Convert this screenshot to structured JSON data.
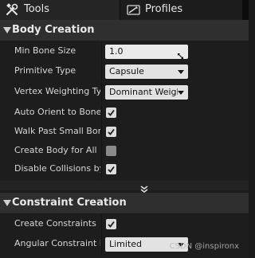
{
  "tabs": [
    {
      "label": "Tools",
      "icon": "tools-icon",
      "active": true
    },
    {
      "label": "Profiles",
      "icon": "profiles-icon",
      "active": false
    }
  ],
  "body_creation": {
    "title": "Body Creation",
    "min_bone_size": {
      "label": "Min Bone Size",
      "value": "1.0"
    },
    "primitive_type": {
      "label": "Primitive Type",
      "value": "Capsule"
    },
    "vertex_weighting_type": {
      "label": "Vertex Weighting Type",
      "value": "Dominant Weight"
    },
    "auto_orient": {
      "label": "Auto Orient to Bone",
      "checked": true
    },
    "walk_past_small_bones": {
      "label": "Walk Past Small Bones",
      "checked": true
    },
    "create_body_for_all_bones": {
      "label": "Create Body for All Bones",
      "checked": false
    },
    "disable_collisions": {
      "label": "Disable Collisions by Default",
      "checked": true
    }
  },
  "constraint_creation": {
    "title": "Constraint Creation",
    "create_constraints": {
      "label": "Create Constraints",
      "checked": true
    },
    "angular_constraint_mode": {
      "label": "Angular Constraint Mode",
      "value": "Limited"
    }
  },
  "watermark": "CSDN @inspironx"
}
